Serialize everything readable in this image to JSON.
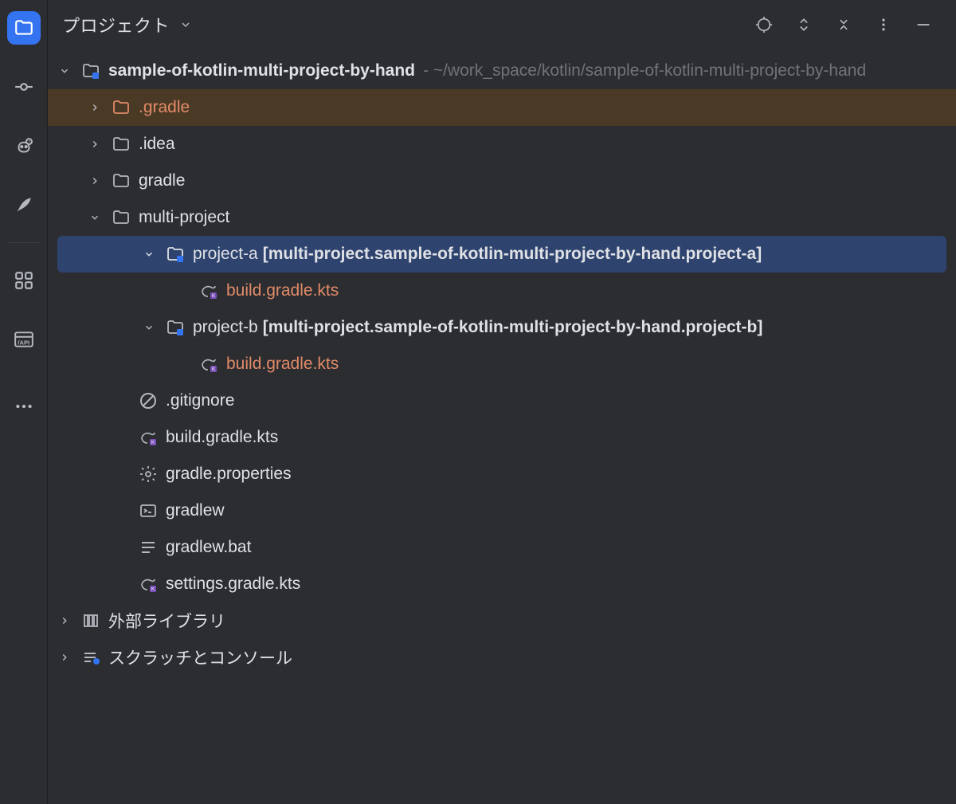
{
  "panel": {
    "title": "プロジェクト"
  },
  "tree": {
    "root_name": "sample-of-kotlin-multi-project-by-hand",
    "root_path": "-  ~/work_space/kotlin/sample-of-kotlin-multi-project-by-hand",
    "gradle_hidden": ".gradle",
    "idea": ".idea",
    "gradle": "gradle",
    "multi_project": "multi-project",
    "project_a": "project-a",
    "project_a_suffix": "[multi-project.sample-of-kotlin-multi-project-by-hand.project-a]",
    "project_a_build": "build.gradle.kts",
    "project_b": "project-b",
    "project_b_suffix": "[multi-project.sample-of-kotlin-multi-project-by-hand.project-b]",
    "project_b_build": "build.gradle.kts",
    "gitignore": ".gitignore",
    "build_gradle": "build.gradle.kts",
    "gradle_properties": "gradle.properties",
    "gradlew": "gradlew",
    "gradlew_bat": "gradlew.bat",
    "settings_gradle": "settings.gradle.kts",
    "external_libs": "外部ライブラリ",
    "scratches": "スクラッチとコンソール"
  }
}
